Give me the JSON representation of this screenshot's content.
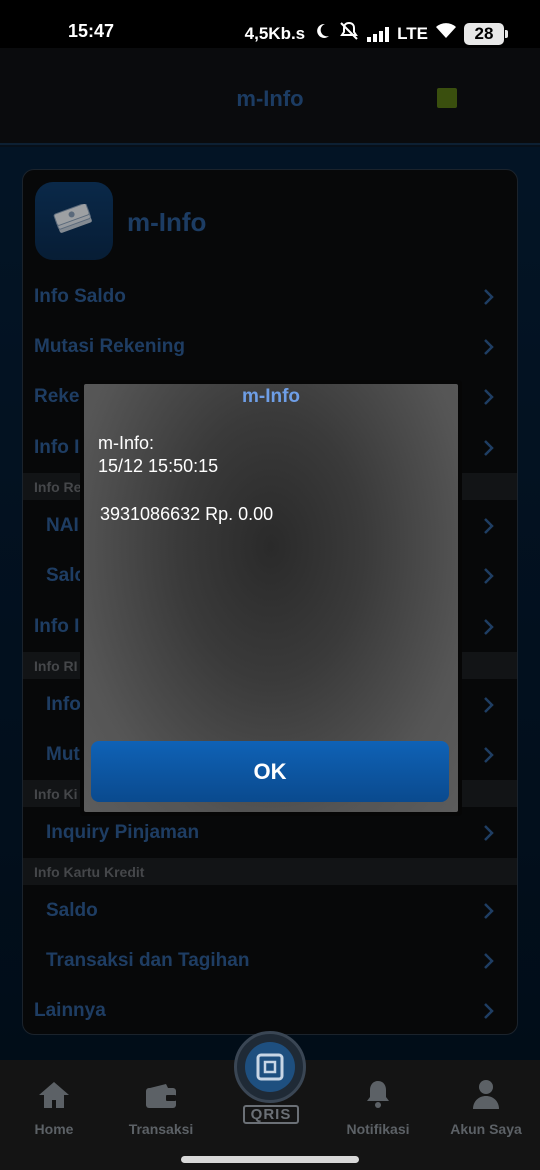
{
  "status_bar": {
    "time": "15:47",
    "network_speed": "4,5Kb.s",
    "network_type": "LTE",
    "battery": "28",
    "icons": [
      "moon-icon",
      "mute-bell-icon",
      "signal-icon",
      "wifi-icon",
      "battery-icon"
    ]
  },
  "header": {
    "title": "m-Info",
    "indicator_color": "#5a7a16"
  },
  "card": {
    "title": "m-Info",
    "logo_icon": "money-stack-icon",
    "rows": [
      {
        "label": "Info Saldo",
        "indent": false
      },
      {
        "label": "Mutasi Rekening",
        "indent": false
      },
      {
        "label": "Reke",
        "indent": false
      },
      {
        "label": "Info I",
        "indent": false
      },
      {
        "label": "NAI",
        "indent": true
      },
      {
        "label": "Salc",
        "indent": true
      },
      {
        "label": "Info I",
        "indent": false
      },
      {
        "label": "Info",
        "indent": true
      },
      {
        "label": "Mut",
        "indent": true
      },
      {
        "label": "Inquiry Pinjaman",
        "indent": true
      },
      {
        "label": "Saldo",
        "indent": true
      },
      {
        "label": "Transaksi dan Tagihan",
        "indent": true
      },
      {
        "label": "Lainnya",
        "indent": false
      }
    ],
    "sections": [
      "Info Re",
      "Info RI",
      "Info Ki",
      "Info Kartu Kredit"
    ]
  },
  "dialog": {
    "title": "m-Info",
    "line1": "m-Info:",
    "line2": "15/12 15:50:15",
    "line3": "3931086632 Rp. 0.00",
    "ok_label": "OK"
  },
  "bottom_nav": {
    "items": [
      {
        "label": "Home",
        "icon": "home-icon"
      },
      {
        "label": "Transaksi",
        "icon": "wallet-icon"
      },
      {
        "label": "Notifikasi",
        "icon": "bell-icon"
      },
      {
        "label": "Akun Saya",
        "icon": "user-icon"
      }
    ],
    "qris_label": "QRIS"
  },
  "colors": {
    "accent": "#2f5e98",
    "dialog_title": "#6e9ee6",
    "ok_button": "#0f62b6"
  }
}
